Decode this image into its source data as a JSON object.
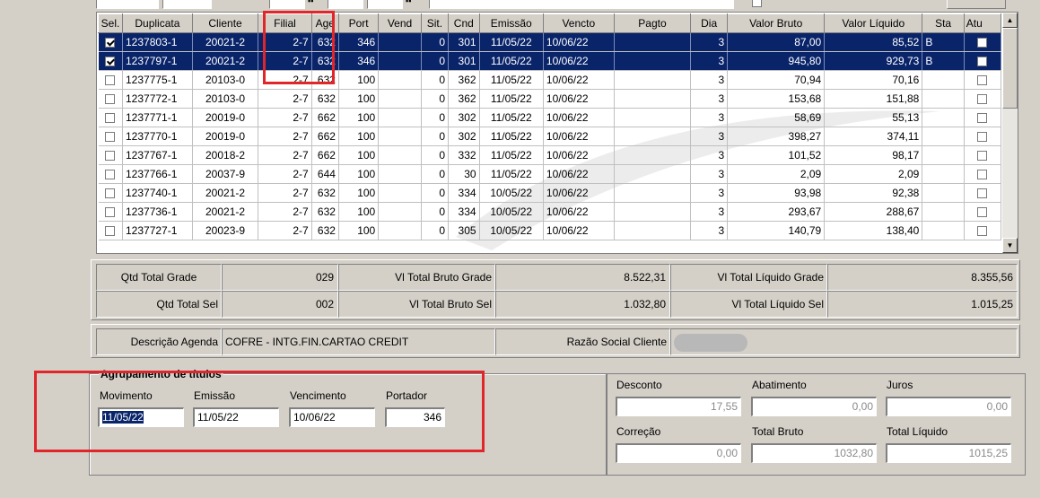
{
  "grid": {
    "columns": [
      "Sel.",
      "Duplicata",
      "Cliente",
      "Filial",
      "Age",
      "Port",
      "Vend",
      "Sit.",
      "Cnd",
      "Emissão",
      "Vencto",
      "Pagto",
      "Dia",
      "Valor Bruto",
      "Valor Líquido",
      "Sta",
      "Atu"
    ],
    "rows": [
      {
        "sel": true,
        "dup": "1237803-1",
        "cli": "20021-2",
        "fil": "2-7",
        "age": "632",
        "port": "346",
        "vend": "",
        "sit": "0",
        "cnd": "301",
        "emi": "11/05/22",
        "venc": "10/06/22",
        "pag": "",
        "dia": "3",
        "vb": "87,00",
        "vl": "85,52",
        "sta": "B",
        "atu": false,
        "selected": true
      },
      {
        "sel": true,
        "dup": "1237797-1",
        "cli": "20021-2",
        "fil": "2-7",
        "age": "632",
        "port": "346",
        "vend": "",
        "sit": "0",
        "cnd": "301",
        "emi": "11/05/22",
        "venc": "10/06/22",
        "pag": "",
        "dia": "3",
        "vb": "945,80",
        "vl": "929,73",
        "sta": "B",
        "atu": false,
        "selected": true
      },
      {
        "sel": false,
        "dup": "1237775-1",
        "cli": "20103-0",
        "fil": "2-7",
        "age": "632",
        "port": "100",
        "vend": "",
        "sit": "0",
        "cnd": "362",
        "emi": "11/05/22",
        "venc": "10/06/22",
        "pag": "",
        "dia": "3",
        "vb": "70,94",
        "vl": "70,16",
        "sta": "",
        "atu": false,
        "selected": false
      },
      {
        "sel": false,
        "dup": "1237772-1",
        "cli": "20103-0",
        "fil": "2-7",
        "age": "632",
        "port": "100",
        "vend": "",
        "sit": "0",
        "cnd": "362",
        "emi": "11/05/22",
        "venc": "10/06/22",
        "pag": "",
        "dia": "3",
        "vb": "153,68",
        "vl": "151,88",
        "sta": "",
        "atu": false,
        "selected": false
      },
      {
        "sel": false,
        "dup": "1237771-1",
        "cli": "20019-0",
        "fil": "2-7",
        "age": "662",
        "port": "100",
        "vend": "",
        "sit": "0",
        "cnd": "302",
        "emi": "11/05/22",
        "venc": "10/06/22",
        "pag": "",
        "dia": "3",
        "vb": "58,69",
        "vl": "55,13",
        "sta": "",
        "atu": false,
        "selected": false
      },
      {
        "sel": false,
        "dup": "1237770-1",
        "cli": "20019-0",
        "fil": "2-7",
        "age": "662",
        "port": "100",
        "vend": "",
        "sit": "0",
        "cnd": "302",
        "emi": "11/05/22",
        "venc": "10/06/22",
        "pag": "",
        "dia": "3",
        "vb": "398,27",
        "vl": "374,11",
        "sta": "",
        "atu": false,
        "selected": false
      },
      {
        "sel": false,
        "dup": "1237767-1",
        "cli": "20018-2",
        "fil": "2-7",
        "age": "662",
        "port": "100",
        "vend": "",
        "sit": "0",
        "cnd": "332",
        "emi": "11/05/22",
        "venc": "10/06/22",
        "pag": "",
        "dia": "3",
        "vb": "101,52",
        "vl": "98,17",
        "sta": "",
        "atu": false,
        "selected": false
      },
      {
        "sel": false,
        "dup": "1237766-1",
        "cli": "20037-9",
        "fil": "2-7",
        "age": "644",
        "port": "100",
        "vend": "",
        "sit": "0",
        "cnd": "30",
        "emi": "11/05/22",
        "venc": "10/06/22",
        "pag": "",
        "dia": "3",
        "vb": "2,09",
        "vl": "2,09",
        "sta": "",
        "atu": false,
        "selected": false
      },
      {
        "sel": false,
        "dup": "1237740-1",
        "cli": "20021-2",
        "fil": "2-7",
        "age": "632",
        "port": "100",
        "vend": "",
        "sit": "0",
        "cnd": "334",
        "emi": "10/05/22",
        "venc": "10/06/22",
        "pag": "",
        "dia": "3",
        "vb": "93,98",
        "vl": "92,38",
        "sta": "",
        "atu": false,
        "selected": false
      },
      {
        "sel": false,
        "dup": "1237736-1",
        "cli": "20021-2",
        "fil": "2-7",
        "age": "632",
        "port": "100",
        "vend": "",
        "sit": "0",
        "cnd": "334",
        "emi": "10/05/22",
        "venc": "10/06/22",
        "pag": "",
        "dia": "3",
        "vb": "293,67",
        "vl": "288,67",
        "sta": "",
        "atu": false,
        "selected": false
      },
      {
        "sel": false,
        "dup": "1237727-1",
        "cli": "20023-9",
        "fil": "2-7",
        "age": "632",
        "port": "100",
        "vend": "",
        "sit": "0",
        "cnd": "305",
        "emi": "10/05/22",
        "venc": "10/06/22",
        "pag": "",
        "dia": "3",
        "vb": "140,79",
        "vl": "138,40",
        "sta": "",
        "atu": false,
        "selected": false
      }
    ]
  },
  "totals": {
    "qtd_grade_label": "Qtd Total Grade",
    "qtd_grade": "029",
    "bruto_grade_label": "Vl Total Bruto Grade",
    "bruto_grade": "8.522,31",
    "liq_grade_label": "Vl Total Líquido Grade",
    "liq_grade": "8.355,56",
    "qtd_sel_label": "Qtd Total Sel",
    "qtd_sel": "002",
    "bruto_sel_label": "Vl Total Bruto Sel",
    "bruto_sel": "1.032,80",
    "liq_sel_label": "Vl Total Líquido Sel",
    "liq_sel": "1.015,25",
    "agenda_label": "Descrição Agenda",
    "agenda_value": "COFRE - INTG.FIN.CARTAO CREDIT",
    "razao_label": "Razão Social Cliente"
  },
  "grouping": {
    "title": "Agrupamento de títulos",
    "movimento_label": "Movimento",
    "movimento": "11/05/22",
    "emissao_label": "Emissão",
    "emissao": "11/05/22",
    "vencimento_label": "Vencimento",
    "vencimento": "10/06/22",
    "portador_label": "Portador",
    "portador": "346"
  },
  "summary": {
    "desconto_label": "Desconto",
    "desconto": "17,55",
    "abatimento_label": "Abatimento",
    "abatimento": "0,00",
    "juros_label": "Juros",
    "juros": "0,00",
    "correcao_label": "Correção",
    "correcao": "0,00",
    "total_bruto_label": "Total Bruto",
    "total_bruto": "1032,80",
    "total_liquido_label": "Total Líquido",
    "total_liquido": "1015,25"
  }
}
